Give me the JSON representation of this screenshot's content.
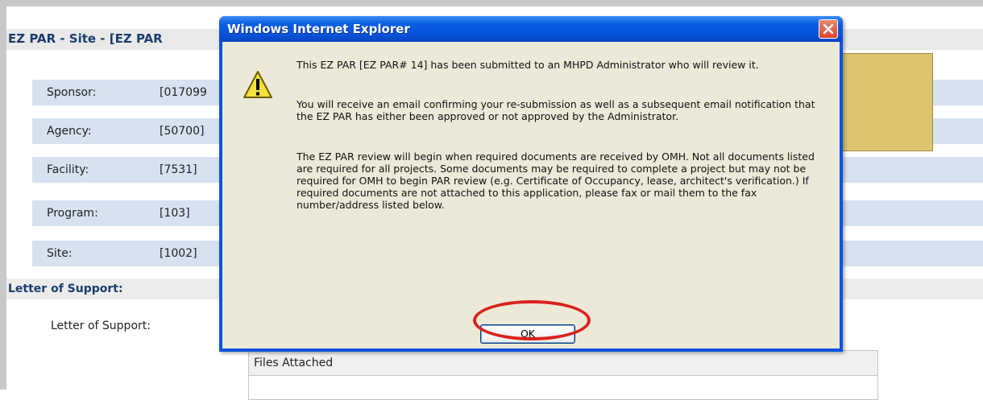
{
  "page": {
    "title": "EZ PAR - Site - [EZ PAR",
    "rows": [
      {
        "label": "Sponsor:",
        "value": "[017099"
      },
      {
        "label": "Agency:",
        "value": "[50700]"
      },
      {
        "label": "Facility:",
        "value": "[7531]"
      },
      {
        "label": "Program:",
        "value": "[103]"
      },
      {
        "label": "Site:",
        "value": "[1002]"
      }
    ],
    "section_title": "Letter of Support:",
    "support_label": "Letter of Support:",
    "files_header": "Files Attached"
  },
  "dialog": {
    "title": "Windows Internet Explorer",
    "icon": "warning-icon",
    "paragraphs": [
      "This EZ PAR [EZ PAR# 14] has been submitted to an MHPD Administrator who will review it.",
      "You will receive an email confirming your re-submission as well as a subsequent email notification that the EZ PAR has either been approved or not approved by the Administrator.",
      "The EZ PAR review will begin when required documents are received by OMH.  Not all documents listed are required for all projects.  Some documents may be required to complete a project but may not be required for OMH to begin PAR review (e.g. Certificate of Occupancy, lease, architect's verification.)  If required documents are not attached to this application, please fax or mail them to the fax number/address listed below."
    ],
    "ok_label": "OK"
  },
  "colors": {
    "highlight_ring": "#d9211c",
    "titlebar": "#0a54e0",
    "row_background": "#d6e2f0"
  }
}
